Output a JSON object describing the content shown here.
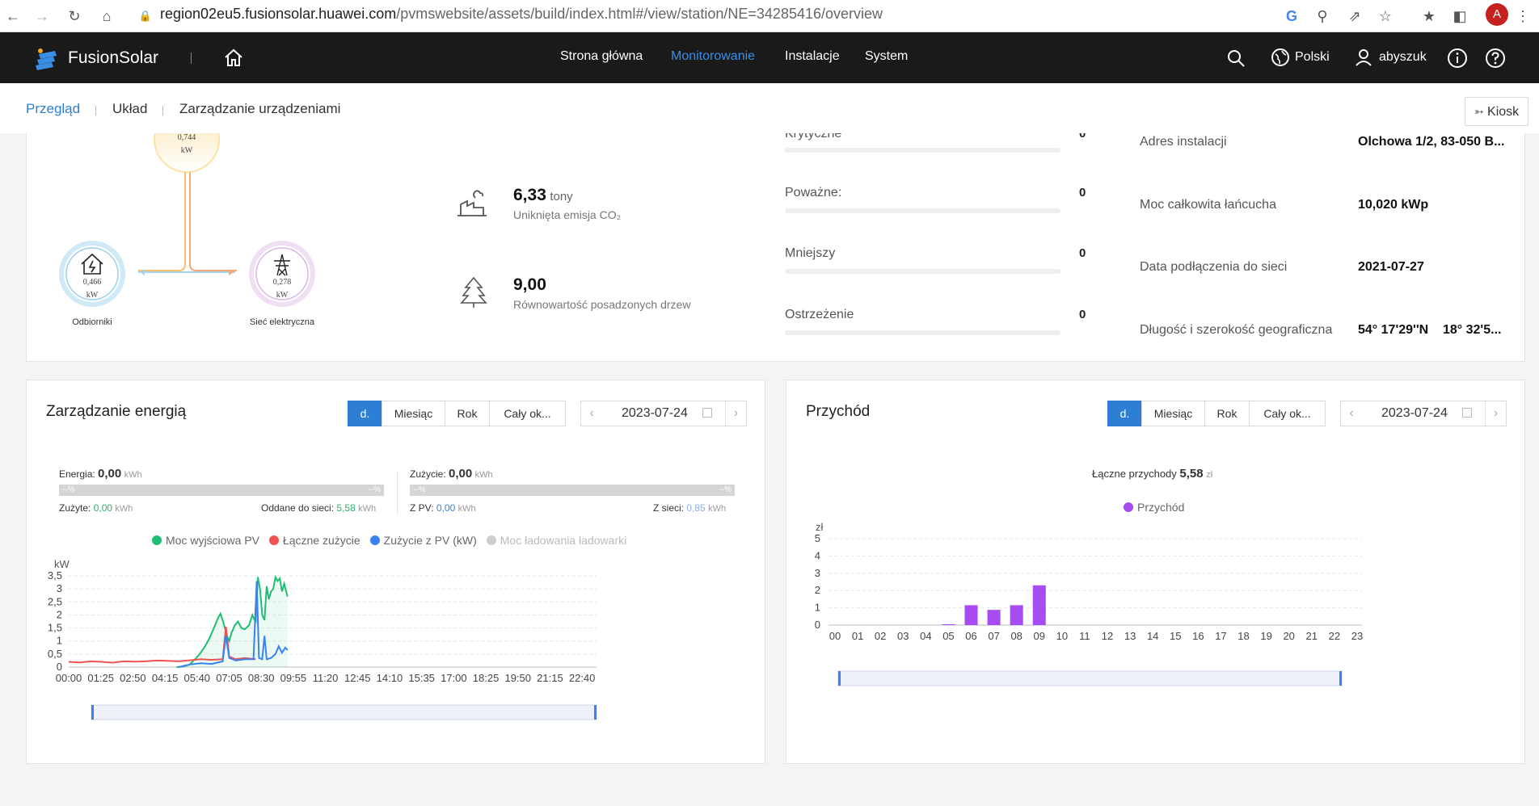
{
  "browser": {
    "url_host": "region02eu5.fusionsolar.huawei.com",
    "url_path": "/pvmswebsite/assets/build/index.html#/view/station/NE=34285416/overview",
    "avatar_letter": "A"
  },
  "header": {
    "logo": "FusionSolar",
    "nav": [
      "Strona główna",
      "Monitorowanie",
      "Instalacje",
      "System"
    ],
    "language": "Polski",
    "user": "abyszuk"
  },
  "subnav": {
    "tabs": [
      "Przegląd",
      "Układ",
      "Zarządzanie urządzeniami"
    ],
    "kiosk": "Kiosk"
  },
  "flow": {
    "pv_value": "0,744",
    "pv_unit": "kW",
    "load_value": "0,466",
    "load_unit": "kW",
    "load_label": "Odbiorniki",
    "grid_value": "0,278",
    "grid_unit": "kW",
    "grid_label": "Sieć elektryczna"
  },
  "env": {
    "co2_value": "6,33",
    "co2_unit": "tony",
    "co2_label": "Uniknięta emisja CO₂",
    "trees_value": "9,00",
    "trees_label": "Równowartość posadzonych drzew"
  },
  "alarms": {
    "partial_label": "Krytyczne",
    "partial_value": "0",
    "items": [
      {
        "label": "Poważne:",
        "value": "0"
      },
      {
        "label": "Mniejszy",
        "value": "0"
      },
      {
        "label": "Ostrzeżenie",
        "value": "0"
      }
    ]
  },
  "info": {
    "items": [
      {
        "label": "Adres instalacji",
        "value": "Olchowa 1/2, 83-050 B..."
      },
      {
        "label": "Moc całkowita łańcucha",
        "value": "10,020 kWp"
      },
      {
        "label": "Data podłączenia do sieci",
        "value": "2021-07-27"
      },
      {
        "label": "Długość i szerokość geograficzna",
        "value": "54° 17'29''N    18° 32'5..."
      }
    ]
  },
  "energy": {
    "title": "Zarządzanie energią",
    "periods": [
      "d.",
      "Miesiąc",
      "Rok",
      "Cały ok..."
    ],
    "date": "2023-07-24",
    "energy_label": "Energia:",
    "energy_value": "0,00",
    "energy_unit": "kWh",
    "consumption_label": "Zużycie:",
    "consumption_value": "0,00",
    "consumption_unit": "kWh",
    "pct_placeholder": "--%",
    "used_label": "Zużyte:",
    "used_value": "0,00",
    "used_unit": "kWh",
    "fed_label": "Oddane do sieci:",
    "fed_value": "5,58",
    "fed_unit": "kWh",
    "from_pv_label": "Z PV:",
    "from_pv_value": "0,00",
    "from_pv_unit": "kWh",
    "from_grid_label": "Z sieci:",
    "from_grid_value": "0,85",
    "from_grid_unit": "kWh"
  },
  "revenue": {
    "title": "Przychód",
    "periods": [
      "d.",
      "Miesiąc",
      "Rok",
      "Cały ok..."
    ],
    "date": "2023-07-24",
    "total_label": "Łączne przychody",
    "total_value": "5,58",
    "total_unit": "zł"
  },
  "colors": {
    "accent": "#2d7fd6",
    "pv": "#1fbf73",
    "consumption": "#f0524f",
    "self_use": "#3a82f0",
    "charger": "#cccccc",
    "revenue": "#a64cf0"
  },
  "chart_data": [
    {
      "type": "line",
      "title": "",
      "ylabel": "kW",
      "ylim": [
        0,
        3.5
      ],
      "yticks": [
        "0",
        "0,5",
        "1",
        "1,5",
        "2",
        "2,5",
        "3",
        "3,5"
      ],
      "xticks": [
        "00:00",
        "01:25",
        "02:50",
        "04:15",
        "05:40",
        "07:05",
        "08:30",
        "09:55",
        "11:20",
        "12:45",
        "14:10",
        "15:35",
        "17:00",
        "18:25",
        "19:50",
        "21:15",
        "22:40"
      ],
      "x_range_hours": [
        0,
        24
      ],
      "series": [
        {
          "name": "Moc wyjściowa PV",
          "color": "#1fbf73",
          "points": [
            [
              4.9,
              0
            ],
            [
              5.2,
              0.02
            ],
            [
              5.5,
              0.1
            ],
            [
              5.8,
              0.35
            ],
            [
              6.0,
              0.55
            ],
            [
              6.2,
              0.8
            ],
            [
              6.4,
              1.1
            ],
            [
              6.6,
              1.5
            ],
            [
              6.8,
              1.9
            ],
            [
              6.9,
              2.05
            ],
            [
              7.0,
              1.8
            ],
            [
              7.1,
              1.5
            ],
            [
              7.2,
              1.2
            ],
            [
              7.3,
              1.0
            ],
            [
              7.4,
              1.3
            ],
            [
              7.55,
              1.6
            ],
            [
              7.7,
              1.75
            ],
            [
              7.85,
              1.5
            ],
            [
              8.0,
              1.45
            ],
            [
              8.2,
              1.6
            ],
            [
              8.35,
              2.0
            ],
            [
              8.5,
              1.7
            ],
            [
              8.6,
              3.45
            ],
            [
              8.7,
              3.0
            ],
            [
              8.8,
              2.0
            ],
            [
              8.9,
              1.8
            ],
            [
              9.0,
              3.1
            ],
            [
              9.1,
              2.6
            ],
            [
              9.2,
              2.9
            ],
            [
              9.3,
              3.0
            ],
            [
              9.4,
              3.45
            ],
            [
              9.5,
              3.3
            ],
            [
              9.6,
              3.4
            ],
            [
              9.7,
              2.9
            ],
            [
              9.8,
              3.2
            ],
            [
              9.95,
              2.7
            ]
          ]
        },
        {
          "name": "Łączne zużycie",
          "color": "#f0524f",
          "points": [
            [
              0,
              0.2
            ],
            [
              0.5,
              0.18
            ],
            [
              1.0,
              0.22
            ],
            [
              1.5,
              0.2
            ],
            [
              2.0,
              0.17
            ],
            [
              2.5,
              0.22
            ],
            [
              3.0,
              0.21
            ],
            [
              3.5,
              0.22
            ],
            [
              4.0,
              0.25
            ],
            [
              4.5,
              0.24
            ],
            [
              5.0,
              0.22
            ],
            [
              5.5,
              0.26
            ],
            [
              6.0,
              0.3
            ],
            [
              6.5,
              0.28
            ],
            [
              7.0,
              0.3
            ],
            [
              7.15,
              1.55
            ],
            [
              7.3,
              0.4
            ],
            [
              7.6,
              0.3
            ],
            [
              8.0,
              0.35
            ],
            [
              8.5,
              0.3
            ]
          ]
        },
        {
          "name": "Zużycie z PV (kW)",
          "color": "#3a82f0",
          "points": [
            [
              5.0,
              0
            ],
            [
              5.5,
              0.1
            ],
            [
              6.0,
              0.15
            ],
            [
              6.5,
              0.12
            ],
            [
              7.0,
              0.22
            ],
            [
              7.15,
              1.2
            ],
            [
              7.3,
              0.35
            ],
            [
              7.6,
              0.25
            ],
            [
              8.0,
              0.3
            ],
            [
              8.4,
              0.3
            ],
            [
              8.55,
              3.3
            ],
            [
              8.65,
              0.35
            ],
            [
              8.8,
              0.3
            ],
            [
              8.9,
              1.2
            ],
            [
              9.0,
              0.3
            ],
            [
              9.2,
              0.35
            ],
            [
              9.4,
              0.5
            ],
            [
              9.55,
              0.8
            ],
            [
              9.7,
              0.55
            ],
            [
              9.85,
              0.75
            ],
            [
              9.95,
              0.65
            ]
          ]
        },
        {
          "name": "Moc ładowania ładowarki",
          "color": "#cccccc",
          "points": []
        }
      ]
    },
    {
      "type": "bar",
      "title": "",
      "ylabel": "zł",
      "ylim": [
        0,
        5
      ],
      "yticks": [
        "0",
        "1",
        "2",
        "3",
        "4",
        "5"
      ],
      "series_name": "Przychód",
      "categories": [
        "00",
        "01",
        "02",
        "03",
        "04",
        "05",
        "06",
        "07",
        "08",
        "09",
        "10",
        "11",
        "12",
        "13",
        "14",
        "15",
        "16",
        "17",
        "18",
        "19",
        "20",
        "21",
        "22",
        "23"
      ],
      "values": [
        0,
        0,
        0,
        0,
        0,
        0.05,
        1.15,
        0.88,
        1.15,
        2.3,
        0,
        0,
        0,
        0,
        0,
        0,
        0,
        0,
        0,
        0,
        0,
        0,
        0,
        0
      ]
    }
  ]
}
